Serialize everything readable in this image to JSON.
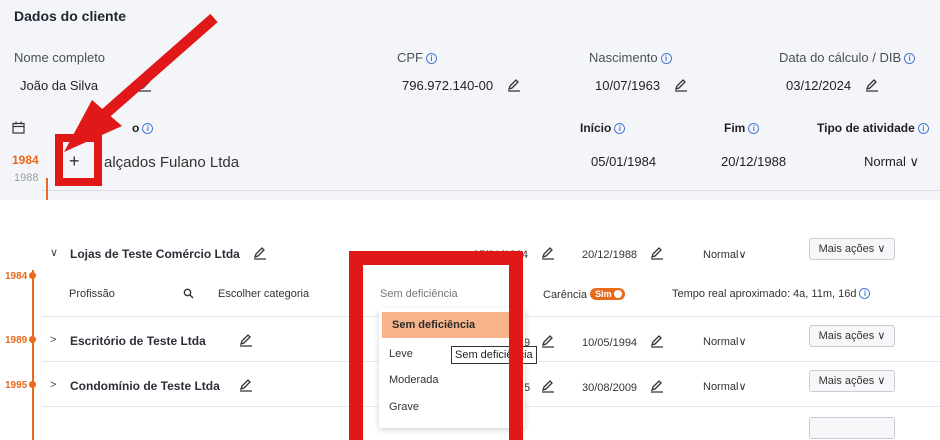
{
  "header": {
    "title": "Dados do cliente",
    "name_label": "Nome completo",
    "name_value": "João da Silva",
    "cpf_label": "CPF",
    "cpf_value": "796.972.140-00",
    "birth_label": "Nascimento",
    "birth_value": "10/07/1963",
    "calc_label": "Data do cálculo / DIB",
    "calc_value": "03/12/2024"
  },
  "periods_header": {
    "inicio": "Início",
    "fim": "Fim",
    "tipo": "Tipo de atividade",
    "partial_col": "o"
  },
  "top_row": {
    "year_start": "1984",
    "year_end": "1988",
    "add_symbol": "+",
    "company": "alçados Fulano Ltda",
    "inicio": "05/01/1984",
    "fim": "20/12/1988",
    "tipo": "Normal"
  },
  "rows": [
    {
      "company": "Lojas de Teste Comércio Ltda",
      "inicio": "05/01/1984",
      "fim": "20/12/1988",
      "tipo": "Normal",
      "more": "Mais ações",
      "year": "1984",
      "chevron": "∨"
    },
    {
      "company": "Escritório de Teste Ltda",
      "inicio": "9",
      "fim": "10/05/1994",
      "tipo": "Normal",
      "more": "Mais ações",
      "year": "1989",
      "chevron": ">"
    },
    {
      "company": "Condomínio de Teste Ltda",
      "inicio": "5",
      "fim": "30/08/2009",
      "tipo": "Normal",
      "more": "Mais ações",
      "year": "1995",
      "chevron": ">"
    }
  ],
  "detail": {
    "profissao": "Profissão",
    "categoria": "Escolher categoria",
    "deficiencia": "Sem deficiência",
    "carencia": "Carência",
    "carencia_toggle": "Sim",
    "tempo_real": "Tempo real aproximado: 4a, 11m, 16d"
  },
  "dropdown_options": [
    "Sem deficiência",
    "Leve",
    "Moderada",
    "Grave"
  ],
  "tooltip": "Sem deficiência",
  "colors": {
    "accent_orange": "#e86a1a",
    "highlight": "#f7b48a",
    "annotation_red": "#e01818",
    "panel_bg": "#f4f5f8"
  }
}
